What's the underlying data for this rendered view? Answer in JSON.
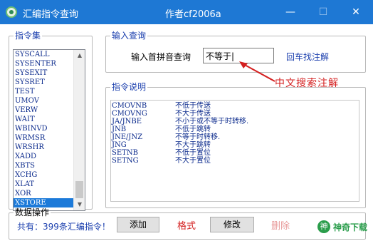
{
  "window": {
    "title": "汇编指令查询",
    "author": "作者cf2006a",
    "min_label": "—",
    "max_label": "☐",
    "close_label": "✕"
  },
  "instruction_set": {
    "legend": "指令集",
    "items": [
      "SYSCALL",
      "SYSENTER",
      "SYSEXIT",
      "SYSRET",
      "TEST",
      "UMOV",
      "VERW",
      "WAIT",
      "WBINVD",
      "WRMSR",
      "WRSHR",
      "XADD",
      "XBTS",
      "XCHG",
      "XLAT",
      "XOR",
      "XSTORE"
    ],
    "selected": "XSTORE"
  },
  "query": {
    "legend": "输入查询",
    "prompt": "输入首拼音查询",
    "value": "不等于|",
    "enter_hint": "回车找注解",
    "annotation": "中文搜索注解"
  },
  "description": {
    "legend": "指令说明",
    "rows": [
      {
        "cmd": "CMOVNB",
        "meaning": "不低于传送"
      },
      {
        "cmd": "CMOVNG",
        "meaning": "不大于传送"
      },
      {
        "cmd": "JA/JNBE",
        "meaning": "不小于或不等于时转移."
      },
      {
        "cmd": "JNB",
        "meaning": "不低于跳转"
      },
      {
        "cmd": "JNE/JNZ",
        "meaning": "不等于时转移."
      },
      {
        "cmd": "JNG",
        "meaning": "不大于跳转"
      },
      {
        "cmd": "SETNB",
        "meaning": "不低于置位"
      },
      {
        "cmd": "SETNG",
        "meaning": "不大于置位"
      }
    ]
  },
  "data_ops": {
    "legend": "数据操作",
    "count_text": "共有：399条汇编指令！",
    "add_label": "添加",
    "format_label": "格式",
    "edit_label": "修改",
    "delete_label": "删除"
  },
  "watermark": {
    "icon_glyph": "神",
    "text": "神奇下载"
  },
  "colors": {
    "titlebar": "#1e78d4",
    "accent_blue": "#1b3fae",
    "annotation_red": "#d42020",
    "selection": "#1c7ad9"
  }
}
